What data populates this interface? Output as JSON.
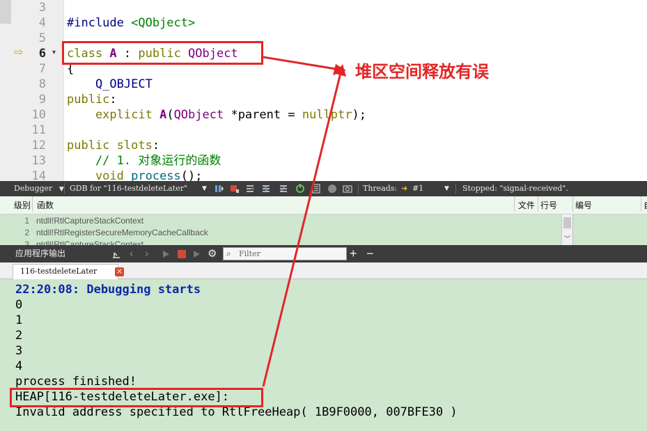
{
  "editor": {
    "lines": [
      {
        "num": "3",
        "segments": []
      },
      {
        "num": "4",
        "segments": [
          {
            "t": "#include ",
            "c": "mac"
          },
          {
            "t": "<QObject>",
            "c": "str"
          }
        ]
      },
      {
        "num": "5",
        "segments": []
      },
      {
        "num": "6",
        "segments": [
          {
            "t": "class ",
            "c": "kw"
          },
          {
            "t": "A",
            "c": "cls"
          },
          {
            "t": " : ",
            "c": ""
          },
          {
            "t": "public ",
            "c": "kw"
          },
          {
            "t": "QObject",
            "c": "typ"
          }
        ]
      },
      {
        "num": "7",
        "segments": [
          {
            "t": "{",
            "c": ""
          }
        ]
      },
      {
        "num": "8",
        "segments": [
          {
            "t": "    Q_OBJECT",
            "c": "mac"
          }
        ]
      },
      {
        "num": "9",
        "segments": [
          {
            "t": "public",
            "c": "kw"
          },
          {
            "t": ":",
            "c": ""
          }
        ]
      },
      {
        "num": "10",
        "segments": [
          {
            "t": "    explicit ",
            "c": "kw"
          },
          {
            "t": "A",
            "c": "cls"
          },
          {
            "t": "(",
            "c": ""
          },
          {
            "t": "QObject",
            "c": "typ"
          },
          {
            "t": " *parent = ",
            "c": ""
          },
          {
            "t": "nullptr",
            "c": "kw"
          },
          {
            "t": ");",
            "c": ""
          }
        ]
      },
      {
        "num": "11",
        "segments": []
      },
      {
        "num": "12",
        "segments": [
          {
            "t": "public ",
            "c": "kw"
          },
          {
            "t": "slots",
            "c": "kw"
          },
          {
            "t": ":",
            "c": ""
          }
        ]
      },
      {
        "num": "13",
        "segments": [
          {
            "t": "    // 1. 对象运行的函数",
            "c": "cmt"
          }
        ]
      },
      {
        "num": "14",
        "segments": [
          {
            "t": "    void ",
            "c": "kw"
          },
          {
            "t": "process",
            "c": "fn"
          },
          {
            "t": "();",
            "c": ""
          }
        ]
      }
    ],
    "current_line": "6"
  },
  "debugger_toolbar": {
    "label": "Debugger",
    "engine": "GDB for \"116-testdeleteLater\"",
    "threads_label": "Threads:",
    "thread_value": "#1",
    "status": "Stopped: \"signal-received\"."
  },
  "stack": {
    "headers": {
      "level": "级别",
      "function": "函数",
      "file": "文件",
      "line": "行号",
      "address": "编号",
      "extra": "自"
    },
    "rows": [
      {
        "level": "1",
        "function": "ntdll!RtlCaptureStackContext"
      },
      {
        "level": "2",
        "function": "ntdll!RtlRegisterSecureMemoryCacheCallback"
      },
      {
        "level": "3",
        "function": "ntdll!RtlCaptureStackContext"
      }
    ]
  },
  "output_panel": {
    "title": "应用程序输出",
    "filter_placeholder": "Filter",
    "tab_label": "116-testdeleteLater",
    "lines": [
      {
        "text": "22:20:08: Debugging starts",
        "style": "hdr"
      },
      {
        "text": "0",
        "style": ""
      },
      {
        "text": "1",
        "style": ""
      },
      {
        "text": "2",
        "style": ""
      },
      {
        "text": "3",
        "style": ""
      },
      {
        "text": "4",
        "style": ""
      },
      {
        "text": "process finished!",
        "style": ""
      },
      {
        "text": "HEAP[116-testdeleteLater.exe]:",
        "style": ""
      },
      {
        "text": "Invalid address specified to RtlFreeHeap( 1B9F0000, 007BFE30 )",
        "style": ""
      }
    ]
  },
  "annotation": {
    "text": "堆区空间释放有误",
    "color": "#e32525"
  }
}
